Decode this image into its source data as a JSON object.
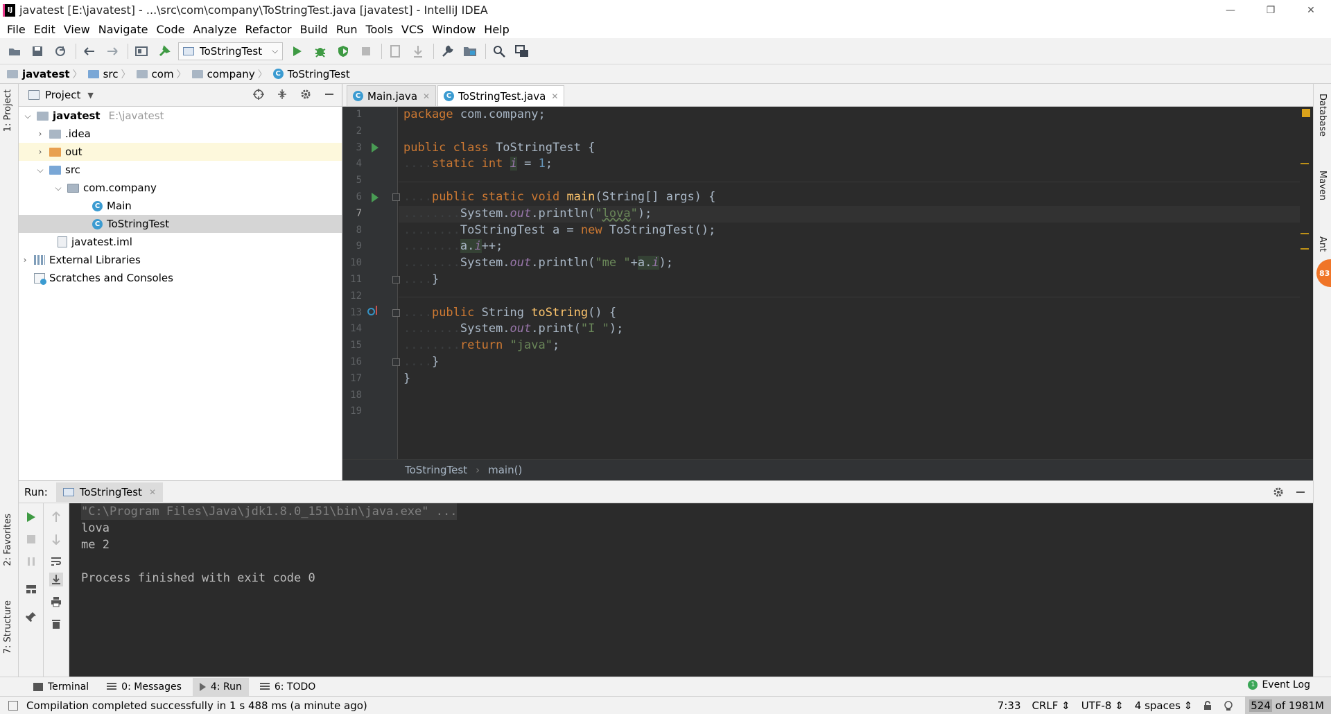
{
  "window": {
    "title": "javatest [E:\\javatest] - ...\\src\\com\\company\\ToStringTest.java [javatest] - IntelliJ IDEA",
    "app_icon_text": "IJ",
    "controls": [
      "—",
      "❐",
      "✕"
    ]
  },
  "menu": [
    "File",
    "Edit",
    "View",
    "Navigate",
    "Code",
    "Analyze",
    "Refactor",
    "Build",
    "Run",
    "Tools",
    "VCS",
    "Window",
    "Help"
  ],
  "toolbar": {
    "run_config": "ToStringTest"
  },
  "breadcrumb": [
    "javatest",
    "src",
    "com",
    "company",
    "ToStringTest"
  ],
  "left_strip": {
    "project_tab": "1: Project",
    "favorites_tab": "2: Favorites",
    "structure_tab": "7: Structure"
  },
  "right_strip": {
    "database_tab": "Database",
    "maven_tab": "Maven",
    "ant_tab": "Ant",
    "badge": "83"
  },
  "project_panel": {
    "title": "Project",
    "tree": [
      {
        "label": "javatest",
        "path": "E:\\javatest"
      },
      {
        "label": ".idea"
      },
      {
        "label": "out"
      },
      {
        "label": "src"
      },
      {
        "label": "com.company"
      },
      {
        "label": "Main"
      },
      {
        "label": "ToStringTest"
      },
      {
        "label": "javatest.iml"
      },
      {
        "label": "External Libraries"
      },
      {
        "label": "Scratches and Consoles"
      }
    ]
  },
  "editor": {
    "tabs": [
      {
        "label": "Main.java",
        "active": false
      },
      {
        "label": "ToStringTest.java",
        "active": true
      }
    ],
    "line_numbers": [
      "1",
      "2",
      "3",
      "4",
      "5",
      "6",
      "7",
      "8",
      "9",
      "10",
      "11",
      "12",
      "13",
      "14",
      "15",
      "16",
      "17",
      "18",
      "19"
    ],
    "current_line": 7,
    "breadcrumb": [
      "ToStringTest",
      "main()"
    ]
  },
  "run_panel": {
    "label": "Run:",
    "tab": "ToStringTest",
    "console": [
      "\"C:\\Program Files\\Java\\jdk1.8.0_151\\bin\\java.exe\" ...",
      "lova",
      "me 2",
      "",
      "Process finished with exit code 0"
    ]
  },
  "bottom_tabs": [
    {
      "label": "Terminal",
      "active": false
    },
    {
      "label": "0: Messages",
      "active": false
    },
    {
      "label": "4: Run",
      "active": true
    },
    {
      "label": "6: TODO",
      "active": false
    }
  ],
  "event_log": "Event Log",
  "status": {
    "message": "Compilation completed successfully in 1 s 488 ms (a minute ago)",
    "position": "7:33",
    "line_sep": "CRLF ⇕",
    "encoding": "UTF-8 ⇕",
    "indent": "4 spaces ⇕",
    "memory_used": "524",
    "memory_total": "of 1981M"
  },
  "colors": {
    "editor_bg": "#2b2b2b",
    "keyword": "#cc7832",
    "string": "#6a8759",
    "number": "#6897bb",
    "field": "#9876aa",
    "method": "#ffc66d",
    "plain": "#a9b7c6"
  }
}
